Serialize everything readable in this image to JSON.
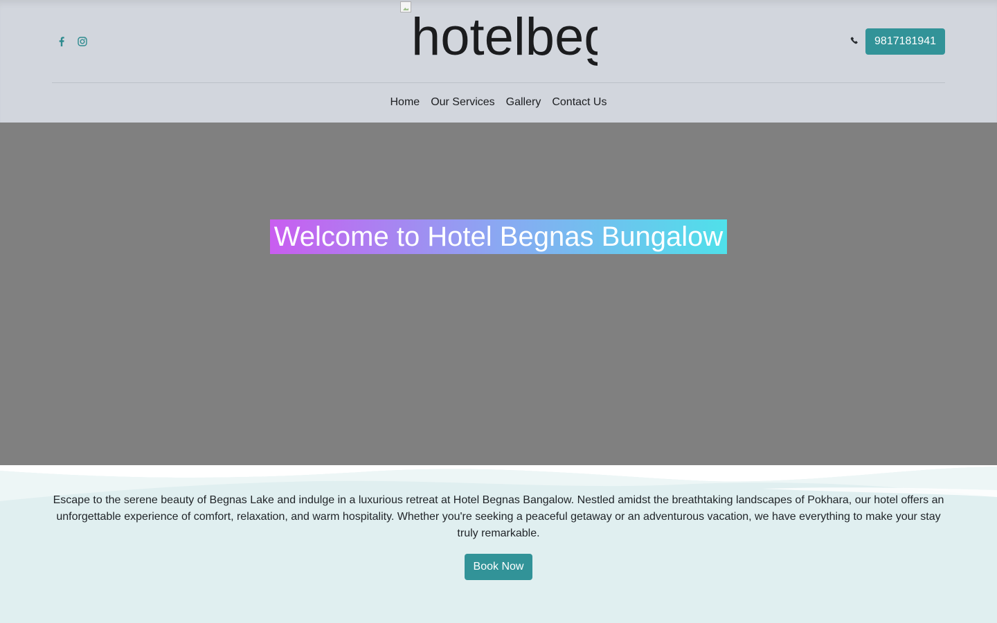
{
  "header": {
    "social": [
      {
        "icon": "facebook-icon"
      },
      {
        "icon": "instagram-icon"
      }
    ],
    "logo_alt": "hotelbegnas",
    "phone_icon": "phone-icon",
    "phone_label": "9817181941"
  },
  "nav": {
    "items": [
      {
        "label": "Home"
      },
      {
        "label": "Our Services"
      },
      {
        "label": "Gallery"
      },
      {
        "label": "Contact Us"
      }
    ]
  },
  "hero": {
    "title": "Welcome to Hotel Begnas Bungalow"
  },
  "intro": {
    "text": "Escape to the serene beauty of Begnas Lake and indulge in a luxurious retreat at Hotel Begnas Bangalow. Nestled amidst the breathtaking landscapes of Pokhara, our hotel offers an unforgettable experience of comfort, relaxation, and warm hospitality. Whether you're seeking a peaceful getaway or an adventurous vacation, we have everything to make your stay truly remarkable.",
    "book_label": "Book Now"
  },
  "colors": {
    "accent": "#329398",
    "header_bg": "#d2d6dd",
    "hero_bg": "#808080",
    "section_bg": "#e0eff0",
    "title_gradient": [
      "#c95df0",
      "#8aa8f2",
      "#4fe0ea"
    ]
  }
}
